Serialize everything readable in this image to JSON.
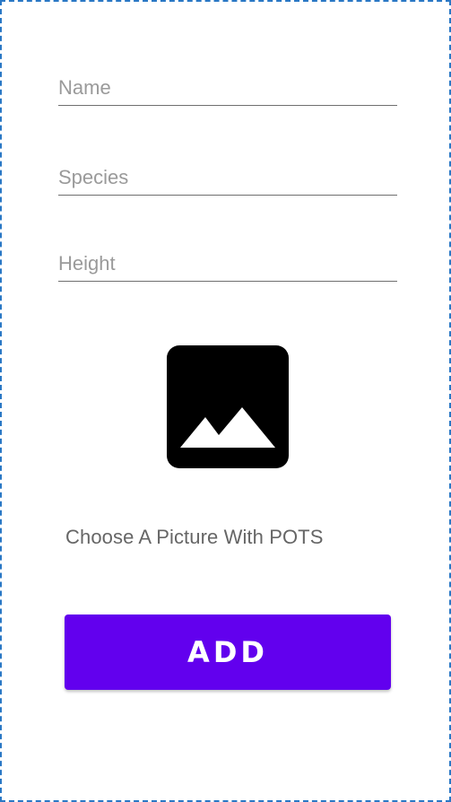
{
  "form": {
    "name_placeholder": "Name",
    "name_value": "",
    "species_placeholder": "Species",
    "species_value": "",
    "height_placeholder": "Height",
    "height_value": ""
  },
  "image_picker": {
    "icon": "image-icon"
  },
  "hint_text": "Choose A Picture With POTS",
  "add_button_label": "ADD",
  "colors": {
    "accent": "#6200ee",
    "underline": "#6f6f6f",
    "placeholder": "#9a9a9a",
    "hint": "#666666"
  }
}
